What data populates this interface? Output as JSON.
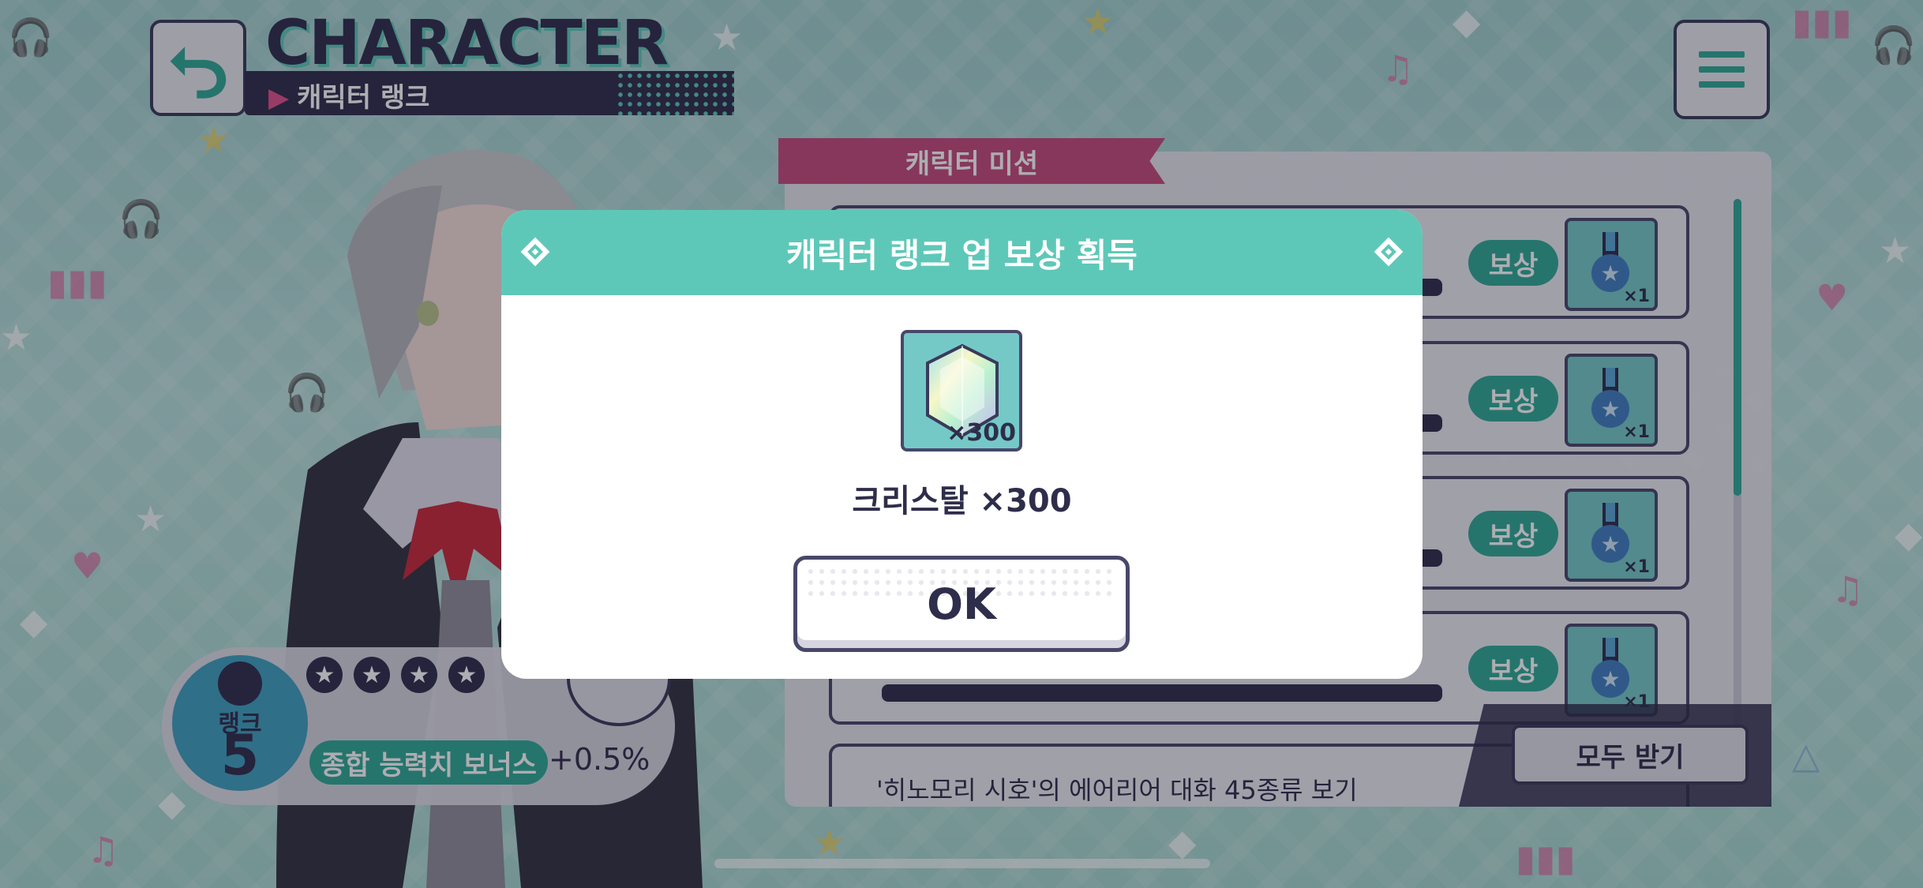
{
  "header": {
    "title": "CHARACTER",
    "subtitle": "캐릭터 랭크"
  },
  "rank": {
    "label": "랭크",
    "value": "5",
    "stars": [
      "★",
      "★",
      "★",
      "★"
    ],
    "bonus_label": "종합 능력치 보너스",
    "bonus_value": "+0.5%"
  },
  "missions": {
    "tab_label": "캐릭터 미션",
    "reward_label": "보상",
    "rows": [
      {
        "reward_qty": "×1"
      },
      {
        "reward_qty": "×1"
      },
      {
        "reward_qty": "×1"
      },
      {
        "reward_qty": "×1"
      }
    ],
    "partial_row_text": "'히노모리 시호'의 에어리어 대화 45종류 보기",
    "receive_all_label": "모두 받기"
  },
  "modal": {
    "title": "캐릭터 랭크 업 보상 획득",
    "item_qty": "×300",
    "item_name": "크리스탈 ×300",
    "ok_label": "OK"
  },
  "colors": {
    "teal": "#5ec8b8",
    "green_pill": "#2fa996",
    "navy": "#2e2d4a",
    "pink": "#c54a7c"
  }
}
